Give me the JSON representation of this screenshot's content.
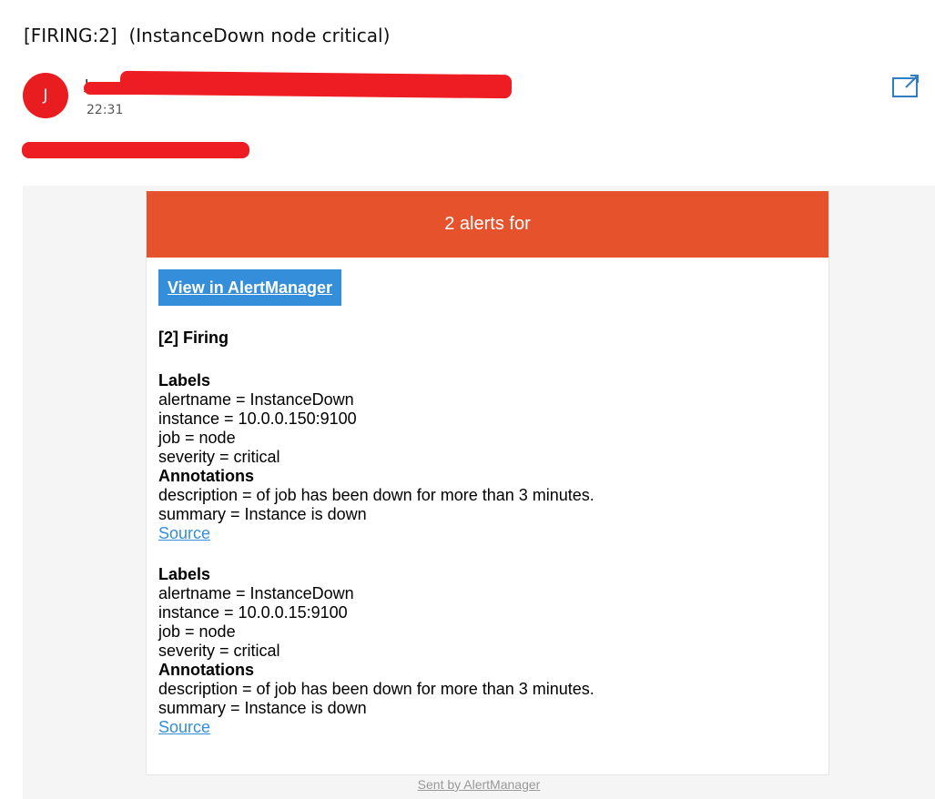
{
  "email": {
    "subject": "[FIRING:2]  (InstanceDown node critical)",
    "sender": {
      "avatar_initial": "J",
      "name": "J...",
      "time": "22:31"
    },
    "to_line": "",
    "icons": {
      "popout": "open-in-new-window-icon"
    }
  },
  "message": {
    "header": "2 alerts for",
    "view_button": "View in AlertManager",
    "firing_title": "[2] Firing",
    "alerts": [
      {
        "labels_heading": "Labels",
        "labels": [
          "alertname = InstanceDown",
          "instance = 10.0.0.150:9100",
          "job = node",
          "severity = critical"
        ],
        "annotations_heading": "Annotations",
        "annotations": [
          "description = of job has been down for more than 3 minutes.",
          "summary = Instance is down"
        ],
        "source_link": "Source"
      },
      {
        "labels_heading": "Labels",
        "labels": [
          "alertname = InstanceDown",
          "instance = 10.0.0.15:9100",
          "job = node",
          "severity = critical"
        ],
        "annotations_heading": "Annotations",
        "annotations": [
          "description = of job has been down for more than 3 minutes.",
          "summary = Instance is down"
        ],
        "source_link": "Source"
      }
    ],
    "footer": "Sent by AlertManager"
  },
  "colors": {
    "banner": "#e6522c",
    "button": "#348eda",
    "avatar": "#e91c20",
    "redaction": "#ee1d23",
    "link": "#348eda"
  }
}
